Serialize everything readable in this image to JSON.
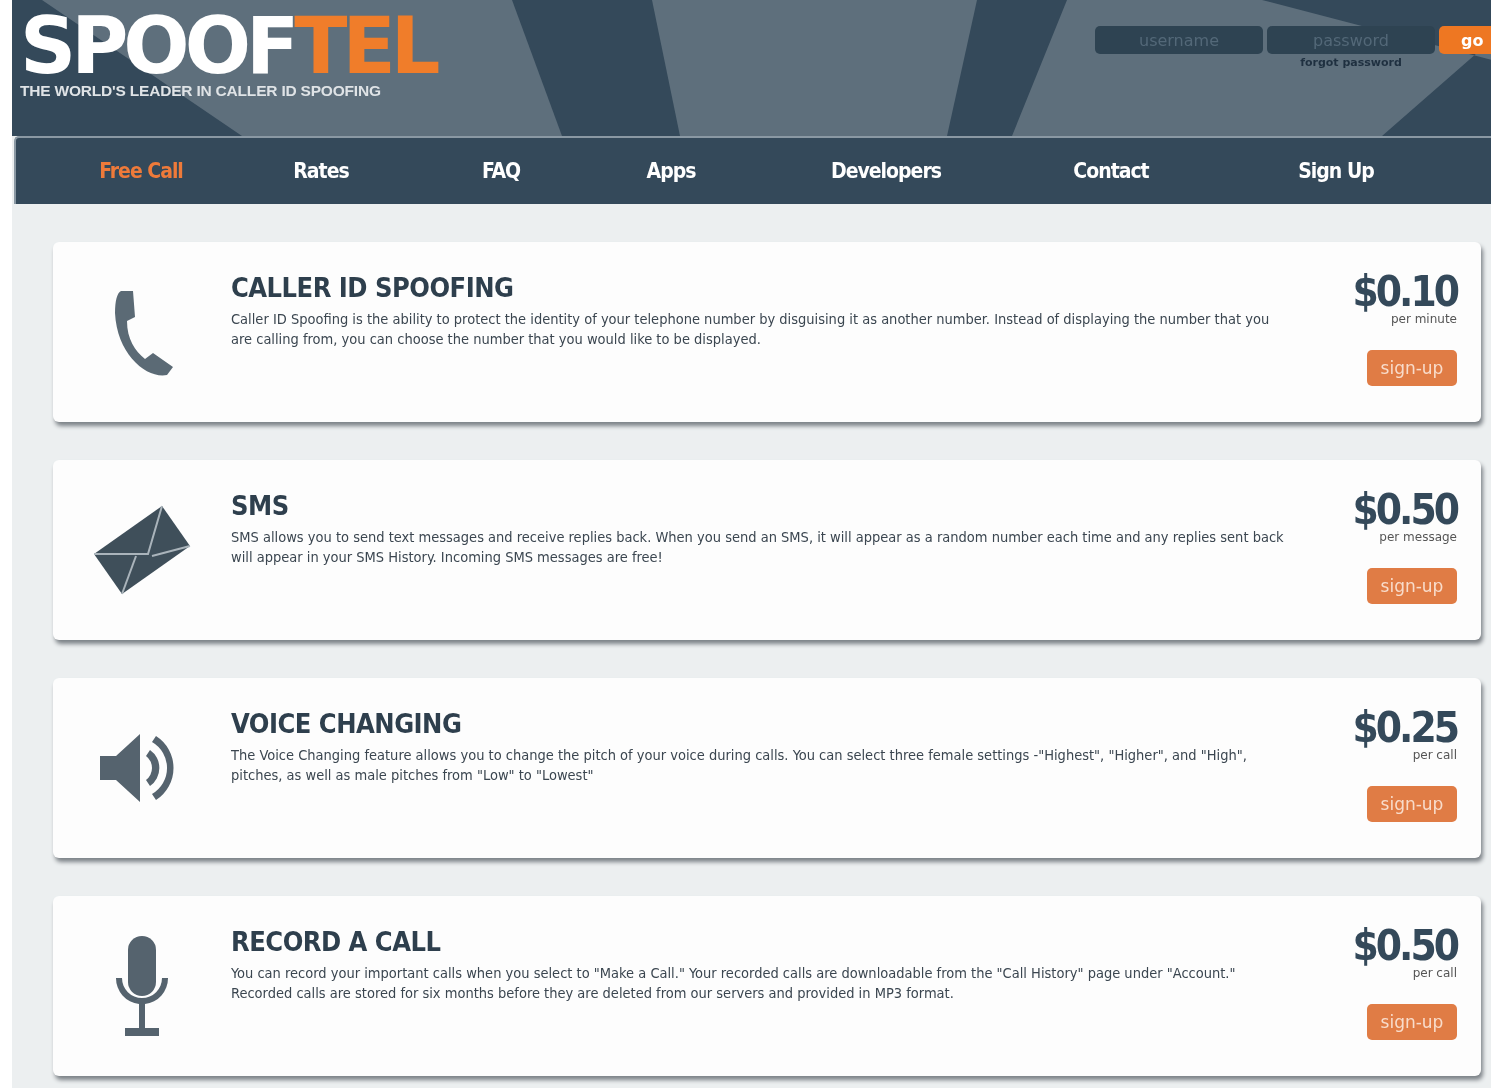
{
  "brand": {
    "name_part_1": "SPOOF",
    "name_part_2": "TEL",
    "tagline": "THE WORLD'S LEADER IN CALLER ID SPOOFING"
  },
  "login": {
    "username": {
      "placeholder": "username"
    },
    "password": {
      "placeholder": "password"
    },
    "submit": "go",
    "forgot": "forgot password"
  },
  "nav": [
    {
      "label": "Free Call",
      "selected": true
    },
    {
      "label": "Rates",
      "selected": false
    },
    {
      "label": "FAQ",
      "selected": false
    },
    {
      "label": "Apps",
      "selected": false
    },
    {
      "label": "Developers",
      "selected": false
    },
    {
      "label": "Contact",
      "selected": false
    },
    {
      "label": "Sign Up",
      "selected": false
    }
  ],
  "services": [
    {
      "kind": "phone",
      "title": "CALLER ID SPOOFING",
      "description": "Caller ID Spoofing is the ability to protect the identity of your telephone number by disguising it as another number. Instead of displaying the number that you are calling from, you can choose the number that you would like to be displayed.",
      "price": "$0.10",
      "unit": "per minute",
      "button": "sign-up"
    },
    {
      "kind": "sms",
      "title": "SMS",
      "description": "SMS allows you to send text messages and receive replies back. When you send an SMS, it will appear as a random number each time and any replies sent back will appear in your SMS History. Incoming SMS messages are free!",
      "price": "$0.50",
      "unit": "per message",
      "button": "sign-up"
    },
    {
      "kind": "voice",
      "title": "VOICE CHANGING",
      "description": "The Voice Changing feature allows you to change the pitch of your voice during calls. You can select three female settings -\"Highest\", \"Higher\", and \"High\", pitches, as well as male pitches from \"Low\" to \"Lowest\"",
      "price": "$0.25",
      "unit": "per call",
      "button": "sign-up"
    },
    {
      "kind": "record",
      "title": "RECORD A CALL",
      "description": "You can record your important calls when you select to \"Make a Call.\" Your recorded calls are downloadable from the \"Call History\" page under \"Account.\" Recorded calls are stored for six months before they are deleted from our servers and provided in MP3 format.",
      "price": "$0.50",
      "unit": "per call",
      "button": "sign-up"
    }
  ]
}
